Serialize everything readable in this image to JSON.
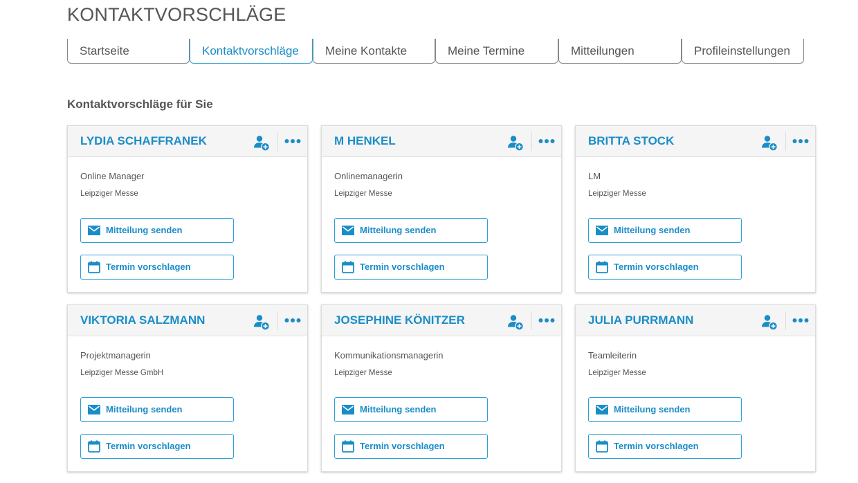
{
  "page": {
    "title": "KONTAKTVORSCHLÄGE"
  },
  "tabs": [
    {
      "label": "Startseite",
      "active": false
    },
    {
      "label": "Kontaktvorschläge",
      "active": true
    },
    {
      "label": "Meine Kontakte",
      "active": false
    },
    {
      "label": "Meine Termine",
      "active": false
    },
    {
      "label": "Mitteilungen",
      "active": false
    },
    {
      "label": "Profileinstellungen",
      "active": false
    }
  ],
  "section": {
    "heading": "Kontaktvorschläge für Sie"
  },
  "cards": [
    {
      "name": "LYDIA SCHAFFRANEK",
      "role": "Online Manager",
      "company": "Leipziger Messe",
      "message_label": "Mitteilung senden",
      "appointment_label": "Termin vorschlagen"
    },
    {
      "name": "M HENKEL",
      "role": "Onlinemanagerin",
      "company": "Leipziger Messe",
      "message_label": "Mitteilung senden",
      "appointment_label": "Termin vorschlagen"
    },
    {
      "name": "BRITTA STOCK",
      "role": "LM",
      "company": "Leipziger Messe",
      "message_label": "Mitteilung senden",
      "appointment_label": "Termin vorschlagen"
    },
    {
      "name": "VIKTORIA SALZMANN",
      "role": "Projektmanagerin",
      "company": "Leipziger Messe GmbH",
      "message_label": "Mitteilung senden",
      "appointment_label": "Termin vorschlagen"
    },
    {
      "name": "JOSEPHINE KÖNITZER",
      "role": "Kommunikationsmanagerin",
      "company": "Leipziger Messe",
      "message_label": "Mitteilung senden",
      "appointment_label": "Termin vorschlagen"
    },
    {
      "name": "JULIA PURRMANN",
      "role": "Teamleiterin",
      "company": "Leipziger Messe",
      "message_label": "Mitteilung senden",
      "appointment_label": "Termin vorschlagen"
    }
  ],
  "icons": {
    "add_contact": "add-contact-icon",
    "more": "more-options-icon",
    "message": "envelope-icon",
    "appointment": "calendar-icon"
  },
  "colors": {
    "accent": "#1a8dc7",
    "accent_border": "#2aa0d8",
    "text": "#555555",
    "card_header_bg": "#f5f5f5"
  }
}
